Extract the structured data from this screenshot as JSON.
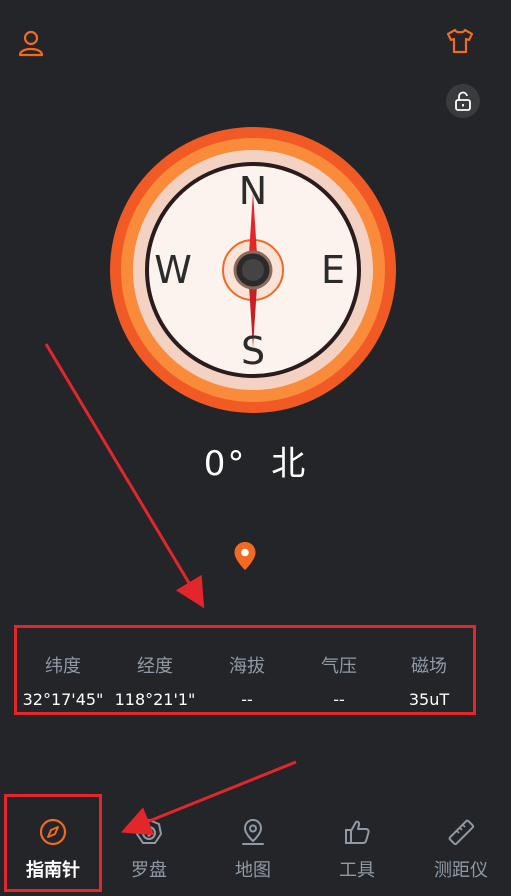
{
  "header": {
    "user_icon": "user-icon",
    "shirt_icon": "shirt-icon",
    "lock_icon": "unlock-icon"
  },
  "compass": {
    "north": "N",
    "south": "S",
    "east": "E",
    "west": "W"
  },
  "heading": {
    "degrees": "0°",
    "direction": "北"
  },
  "location": {
    "pin_icon": "location-pin-icon"
  },
  "info": [
    {
      "label": "纬度",
      "value": "32°17'45\""
    },
    {
      "label": "经度",
      "value": "118°21'1\""
    },
    {
      "label": "海拔",
      "value": "--"
    },
    {
      "label": "气压",
      "value": "--"
    },
    {
      "label": "磁场",
      "value": "35uT"
    }
  ],
  "nav": [
    {
      "label": "指南针",
      "icon": "compass-icon",
      "active": true
    },
    {
      "label": "罗盘",
      "icon": "luopan-icon",
      "active": false
    },
    {
      "label": "地图",
      "icon": "map-pin-icon",
      "active": false
    },
    {
      "label": "工具",
      "icon": "thumbs-up-icon",
      "active": false
    },
    {
      "label": "测距仪",
      "icon": "ruler-icon",
      "active": false
    }
  ],
  "colors": {
    "accent": "#f26a21",
    "highlight_box": "#e3262b",
    "background": "#242528",
    "muted_text": "#8f9aa6"
  }
}
